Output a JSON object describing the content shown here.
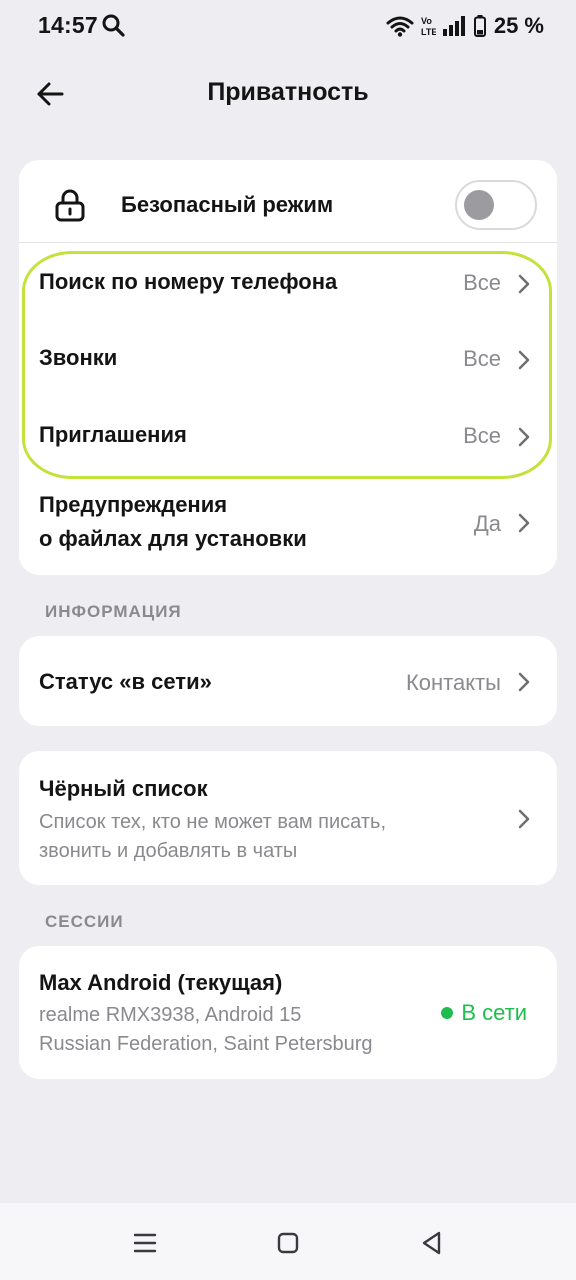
{
  "status_bar": {
    "time": "14:57",
    "battery": "25 %",
    "icons": [
      "search-icon",
      "wifi-icon",
      "volte-icon",
      "signal-icon",
      "battery-icon"
    ]
  },
  "header": {
    "title": "Приватность",
    "back_icon": "arrow-left-icon"
  },
  "privacy": {
    "safe_mode": {
      "label": "Безопасный режим",
      "enabled": false,
      "icon": "lock-icon"
    },
    "items": [
      {
        "label": "Поиск по номеру телефона",
        "value": "Все"
      },
      {
        "label": "Звонки",
        "value": "Все"
      },
      {
        "label": "Приглашения",
        "value": "Все"
      }
    ],
    "warnings": {
      "label_line1": "Предупреждения",
      "label_line2": "о файлах для установки",
      "value": "Да"
    }
  },
  "info_section": {
    "title": "ИНФОРМАЦИЯ",
    "online_status": {
      "label": "Статус «в сети»",
      "value": "Контакты"
    }
  },
  "blacklist": {
    "title": "Чёрный список",
    "desc_line1": "Список тех, кто не может вам писать,",
    "desc_line2": "звонить и добавлять в чаты"
  },
  "sessions_section": {
    "title": "СЕССИИ",
    "session": {
      "name": "Max Android (текущая)",
      "device": "realme RMX3938, Android 15",
      "location": "Russian Federation, Saint Petersburg",
      "status": "В сети"
    }
  },
  "colors": {
    "background": "#ededf2",
    "card": "#ffffff",
    "highlight": "#c4e23c",
    "online": "#1fbd4d",
    "secondary_text": "#8a8a8e"
  },
  "nav_bar": {
    "icons": [
      "menu-icon",
      "home-icon",
      "back-triangle-icon"
    ]
  }
}
